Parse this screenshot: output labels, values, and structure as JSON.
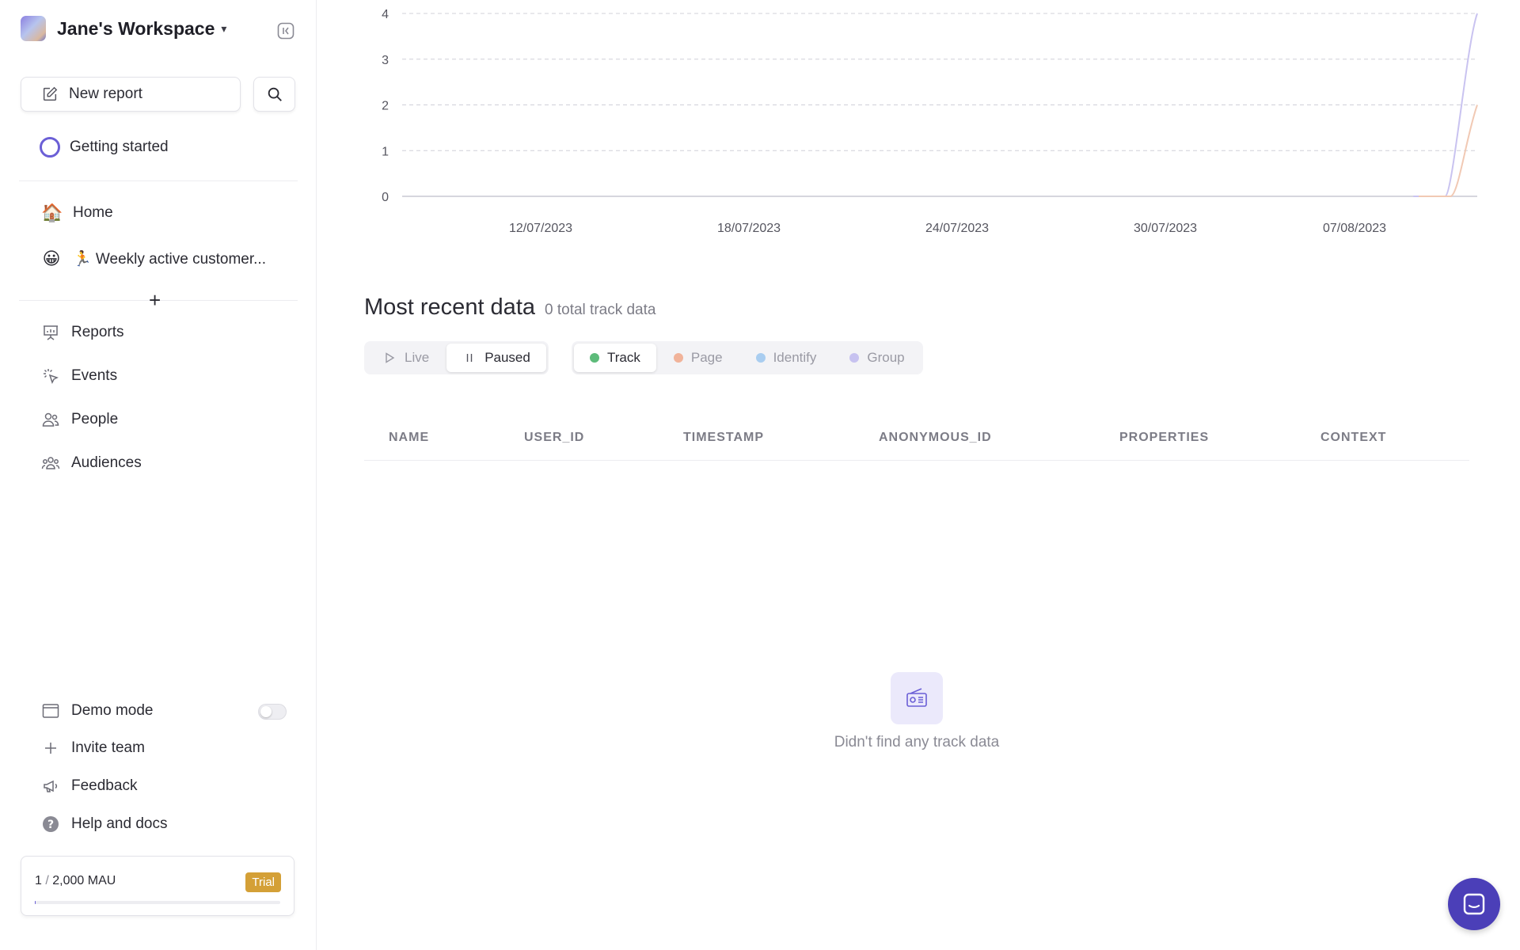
{
  "workspace": {
    "name": "Jane's Workspace",
    "chevron": "▾"
  },
  "sidebar": {
    "new_report_label": "New report",
    "getting_started_label": "Getting started",
    "pinned": [
      {
        "emoji": "🏠",
        "label": "Home"
      },
      {
        "emoji": "😀",
        "label": "🏃 Weekly active customer..."
      }
    ],
    "add_label": "+",
    "nav": [
      {
        "icon": "presentation-chart-icon",
        "label": "Reports"
      },
      {
        "icon": "sparkle-cursor-icon",
        "label": "Events"
      },
      {
        "icon": "people-icon",
        "label": "People"
      },
      {
        "icon": "audience-group-icon",
        "label": "Audiences"
      }
    ],
    "bottom": [
      {
        "icon": "window-icon",
        "label": "Demo mode"
      },
      {
        "icon": "plus-icon",
        "label": "Invite team"
      },
      {
        "icon": "megaphone-icon",
        "label": "Feedback"
      },
      {
        "icon": "help-circle-icon",
        "label": "Help and docs"
      }
    ],
    "demo_mode_on": false,
    "mau": {
      "used": "1",
      "sep": " / ",
      "total": "2,000 MAU",
      "badge": "Trial",
      "fraction": 0.0005
    }
  },
  "chart_data": {
    "type": "line",
    "x": [
      "12/07/2023",
      "18/07/2023",
      "24/07/2023",
      "30/07/2023",
      "07/08/2023"
    ],
    "ylim": [
      0,
      4
    ],
    "yticks": [
      "0",
      "1",
      "2",
      "3",
      "4"
    ],
    "grid": true,
    "series": [
      {
        "color": "#c9c3f0",
        "points": [
          [
            0.97,
            0
          ],
          [
            1.0,
            4
          ]
        ]
      },
      {
        "color": "#f1c9b4",
        "points": [
          [
            0.975,
            0
          ],
          [
            1.0,
            2
          ]
        ]
      }
    ]
  },
  "recent": {
    "title": "Most recent data",
    "count_label": "0 total track data",
    "stream_tabs": [
      {
        "icon": "play-icon",
        "label": "Live",
        "active": false
      },
      {
        "icon": "pause-icon",
        "label": "Paused",
        "active": true
      }
    ],
    "type_tabs": [
      {
        "label": "Track",
        "color": "#5dbb7a",
        "active": true
      },
      {
        "label": "Page",
        "color": "#f1b39a",
        "active": false
      },
      {
        "label": "Identify",
        "color": "#a9cdf0",
        "active": false
      },
      {
        "label": "Group",
        "color": "#c7c2f0",
        "active": false
      }
    ],
    "columns": [
      "NAME",
      "USER_ID",
      "TIMESTAMP",
      "ANONYMOUS_ID",
      "PROPERTIES",
      "CONTEXT"
    ],
    "empty_text": "Didn't find any track data"
  },
  "colors": {
    "accent": "#6b5fd6",
    "fab": "#4b3fb8",
    "trial": "#d4a037"
  }
}
